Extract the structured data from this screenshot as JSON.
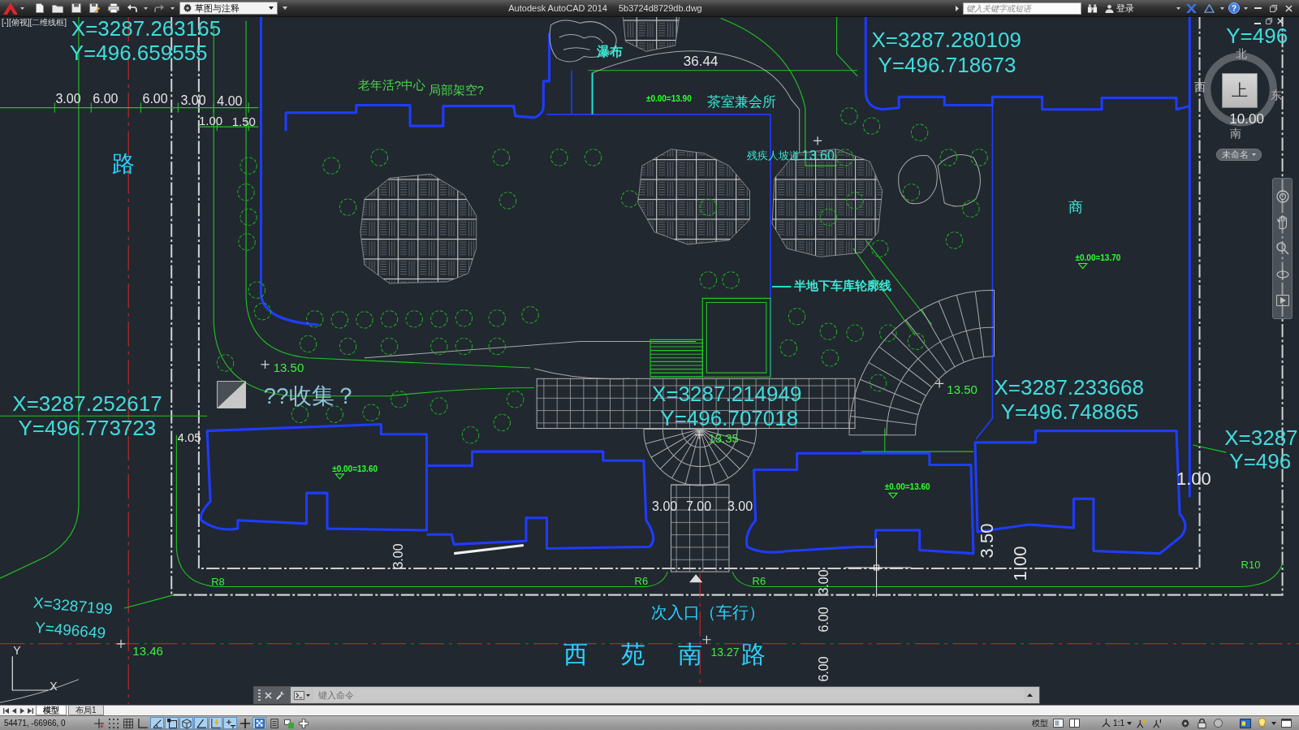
{
  "title_bar": {
    "workspace": "草图与注释",
    "app_name": "Autodesk AutoCAD 2014",
    "file_name": "5b3724d8729db.dwg",
    "search": {
      "placeholder": "键入关键字或短语"
    },
    "login": "登录",
    "help": "?"
  },
  "viewport": {
    "label": "[-][俯视][二维线框]"
  },
  "drawing": {
    "labels": [
      {
        "kind": "coordinate",
        "text": "X=3287.263165"
      },
      {
        "kind": "coordinate",
        "text": "X=3287.280109"
      },
      {
        "kind": "coordinate",
        "text": "Y=496"
      },
      {
        "kind": "coordinate",
        "text": "Y=496.659555"
      },
      {
        "kind": "annotation",
        "text": "瀑布"
      },
      {
        "kind": "dimension",
        "text": "36.44"
      },
      {
        "kind": "coordinate",
        "text": "Y=496.718673"
      },
      {
        "kind": "remark",
        "text": "老年活?中心"
      },
      {
        "kind": "remark",
        "text": "局部架空?"
      },
      {
        "kind": "dimension",
        "text": "3.00"
      },
      {
        "kind": "dimension",
        "text": "6.00"
      },
      {
        "kind": "dimension",
        "text": "6.00"
      },
      {
        "kind": "dimension",
        "text": "3.00"
      },
      {
        "kind": "dimension",
        "text": "4.00"
      },
      {
        "kind": "level",
        "text": "±0.00=13.90"
      },
      {
        "kind": "annotation",
        "text": "茶室兼会所"
      },
      {
        "kind": "dimension",
        "text": "1.00"
      },
      {
        "kind": "dimension",
        "text": "1.50"
      },
      {
        "kind": "dimension",
        "text": "10.00"
      },
      {
        "kind": "road",
        "text": "路"
      },
      {
        "kind": "annotation",
        "text": "残疾人坡道"
      },
      {
        "kind": "annotation",
        "text": "13.60"
      },
      {
        "kind": "annotation",
        "text": "商"
      },
      {
        "kind": "level",
        "text": "±0.00=13.70"
      },
      {
        "kind": "annotation",
        "text": "半地下车库轮廓线"
      },
      {
        "kind": "elevation",
        "text": "13.50"
      },
      {
        "kind": "coordinate",
        "text": "X=3287.252617"
      },
      {
        "kind": "caption",
        "text": "??收集？"
      },
      {
        "kind": "coordinate",
        "text": "X=3287.214949"
      },
      {
        "kind": "elevation",
        "text": "13.50"
      },
      {
        "kind": "coordinate",
        "text": "X=3287.233668"
      },
      {
        "kind": "coordinate",
        "text": "Y=496.773723"
      },
      {
        "kind": "coordinate",
        "text": "Y=496.707018"
      },
      {
        "kind": "coordinate",
        "text": "Y=496.748865"
      },
      {
        "kind": "dimension",
        "text": "4.05"
      },
      {
        "kind": "elevation",
        "text": "13.35"
      },
      {
        "kind": "coordinate",
        "text": "X=3287"
      },
      {
        "kind": "level",
        "text": "±0.00=13.60"
      },
      {
        "kind": "coordinate",
        "text": "Y=496"
      },
      {
        "kind": "level",
        "text": "±0.00=13.60"
      },
      {
        "kind": "dimension",
        "text": "1.00"
      },
      {
        "kind": "dimension",
        "text": "3.00"
      },
      {
        "kind": "dimension",
        "text": "7.00"
      },
      {
        "kind": "dimension",
        "text": "3.00"
      },
      {
        "kind": "dimension",
        "text": "3.00"
      },
      {
        "kind": "dimension",
        "text": "3.50"
      },
      {
        "kind": "dimension",
        "text": "1.00"
      },
      {
        "kind": "elevation",
        "text": "R10"
      },
      {
        "kind": "elevation",
        "text": "R8"
      },
      {
        "kind": "elevation",
        "text": "R6"
      },
      {
        "kind": "elevation",
        "text": "R6"
      },
      {
        "kind": "dimension",
        "text": "3.00"
      },
      {
        "kind": "coordinate",
        "text": "X=3287199"
      },
      {
        "kind": "road",
        "text": "次入口（车行）"
      },
      {
        "kind": "coordinate",
        "text": "Y=496649"
      },
      {
        "kind": "dimension",
        "text": "6.00"
      },
      {
        "kind": "elevation",
        "text": "13.46"
      },
      {
        "kind": "road",
        "text": "西"
      },
      {
        "kind": "road",
        "text": "苑"
      },
      {
        "kind": "road",
        "text": "南"
      },
      {
        "kind": "elevation",
        "text": "13.27"
      },
      {
        "kind": "road",
        "text": "路"
      },
      {
        "kind": "dimension",
        "text": "6.00"
      }
    ]
  },
  "viewcube": {
    "face": "上",
    "north": "北",
    "west": "西",
    "east": "东",
    "south": "南",
    "ucs_menu": "未命名"
  },
  "ucs_icon": {
    "y_axis": "Y",
    "x_axis": "X"
  },
  "command_line": {
    "placeholder": "键入命令"
  },
  "layout_tabs": [
    {
      "label": "模型",
      "selected": true
    },
    {
      "label": "布局1",
      "selected": false
    }
  ],
  "status_bar": {
    "coordinates": "54471, -66966, 0",
    "toggles": [
      {
        "kind": "infer",
        "on": false
      },
      {
        "kind": "snap",
        "on": false
      },
      {
        "kind": "grid",
        "on": false
      },
      {
        "kind": "ortho",
        "on": false
      },
      {
        "kind": "polar",
        "on": true
      },
      {
        "kind": "osnap",
        "on": true
      },
      {
        "kind": "osnap3d",
        "on": true
      },
      {
        "kind": "otrack",
        "on": true
      },
      {
        "kind": "ducs",
        "on": true
      },
      {
        "kind": "dyn",
        "on": true
      },
      {
        "kind": "lwt",
        "on": false
      },
      {
        "kind": "transparency",
        "on": true
      },
      {
        "kind": "quickprops",
        "on": false
      },
      {
        "kind": "selcycle",
        "on": false
      },
      {
        "kind": "annomonitor",
        "on": false
      }
    ],
    "space": "模型",
    "annotation_scale": "1:1"
  }
}
